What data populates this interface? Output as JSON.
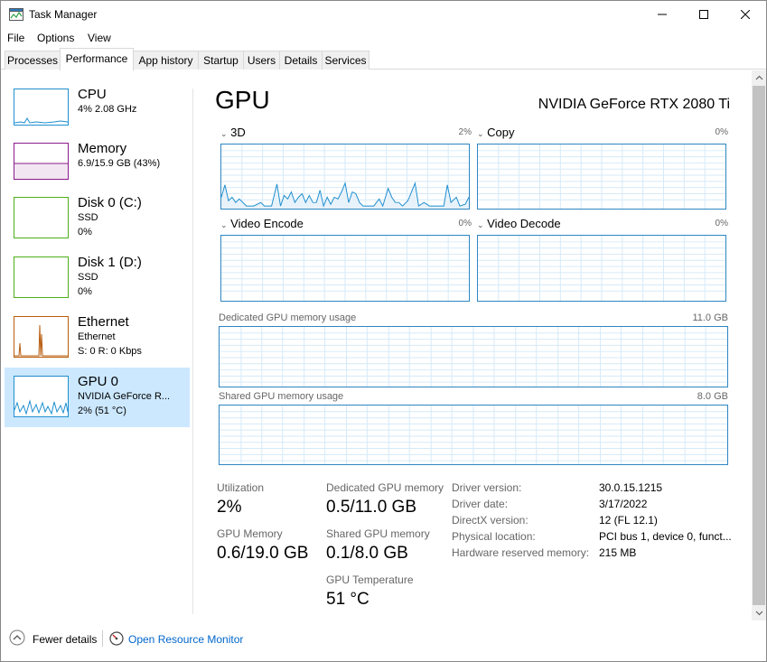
{
  "window": {
    "title": "Task Manager",
    "controls": [
      "minimize",
      "maximize",
      "close"
    ]
  },
  "menu": [
    "File",
    "Options",
    "View"
  ],
  "tabs": [
    "Processes",
    "Performance",
    "App history",
    "Startup",
    "Users",
    "Details",
    "Services"
  ],
  "active_tab": "Performance",
  "sidebar": [
    {
      "name": "CPU",
      "line1": "4%  2.08 GHz",
      "line2": "",
      "color": "#1f8fcf"
    },
    {
      "name": "Memory",
      "line1": "6.9/15.9 GB (43%)",
      "line2": "",
      "color": "#8b1a8b"
    },
    {
      "name": "Disk 0 (C:)",
      "line1": "SSD",
      "line2": "0%",
      "color": "#4caf1a"
    },
    {
      "name": "Disk 1 (D:)",
      "line1": "SSD",
      "line2": "0%",
      "color": "#4caf1a"
    },
    {
      "name": "Ethernet",
      "line1": "Ethernet",
      "line2": "S: 0  R: 0 Kbps",
      "color": "#b85d0f"
    },
    {
      "name": "GPU 0",
      "line1": "NVIDIA GeForce R...",
      "line2": "2%  (51 °C)",
      "color": "#1f8fcf",
      "selected": true
    }
  ],
  "main": {
    "title": "GPU",
    "model": "NVIDIA GeForce RTX 2080 Ti",
    "engines": [
      {
        "name": "3D",
        "pct": "2%"
      },
      {
        "name": "Copy",
        "pct": "0%"
      },
      {
        "name": "Video Encode",
        "pct": "0%"
      },
      {
        "name": "Video Decode",
        "pct": "0%"
      }
    ],
    "dedicated": {
      "label": "Dedicated GPU memory usage",
      "max": "11.0 GB"
    },
    "shared": {
      "label": "Shared GPU memory usage",
      "max": "8.0 GB"
    },
    "stats": {
      "utilization_label": "Utilization",
      "utilization_value": "2%",
      "dedicated_label": "Dedicated GPU memory",
      "dedicated_value": "0.5/11.0 GB",
      "gpu_memory_label": "GPU Memory",
      "gpu_memory_value": "0.6/19.0 GB",
      "shared_label": "Shared GPU memory",
      "shared_value": "0.1/8.0 GB",
      "temp_label": "GPU Temperature",
      "temp_value": "51 °C"
    },
    "info": [
      {
        "label": "Driver version:",
        "value": "30.0.15.1215"
      },
      {
        "label": "Driver date:",
        "value": "3/17/2022"
      },
      {
        "label": "DirectX version:",
        "value": "12 (FL 12.1)"
      },
      {
        "label": "Physical location:",
        "value": "PCI bus 1, device 0, funct..."
      },
      {
        "label": "Hardware reserved memory:",
        "value": "215 MB"
      }
    ]
  },
  "footer": {
    "fewer_details": "Fewer details",
    "open_resmon": "Open Resource Monitor"
  },
  "colors": {
    "graph_border": "#2e86c1",
    "grid": "#d6eaf8",
    "selected_bg": "#cce8ff",
    "link": "#0066cc"
  }
}
